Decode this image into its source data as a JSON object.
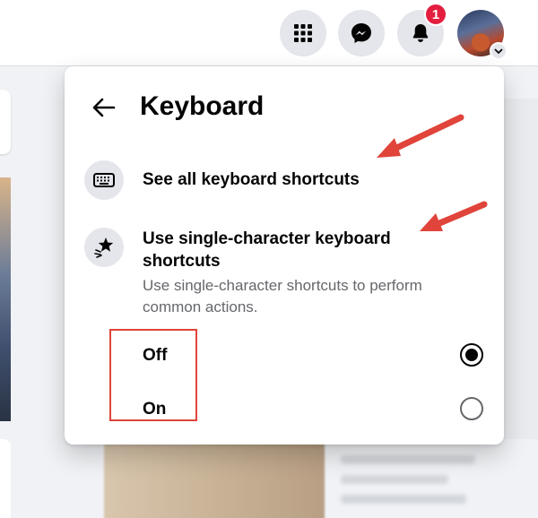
{
  "topbar": {
    "apps_icon": "grid-menu-icon",
    "messenger_icon": "messenger-icon",
    "notifications_icon": "bell-icon",
    "notification_count": "1",
    "avatar_caret_icon": "chevron-down-icon"
  },
  "panel": {
    "title": "Keyboard",
    "back_icon": "back-arrow-icon",
    "see_all": {
      "label": "See all keyboard shortcuts",
      "icon": "keyboard-icon"
    },
    "single_char": {
      "label": "Use single-character keyboard shortcuts",
      "description": "Use single-character shortcuts to perform common actions.",
      "icon": "shortcut-star-icon"
    },
    "options": [
      {
        "label": "Off",
        "selected": true
      },
      {
        "label": "On",
        "selected": false
      }
    ]
  },
  "colors": {
    "annotation_red": "#e0443a",
    "badge_red": "#e41e3f",
    "secondary_text": "#65676b"
  }
}
